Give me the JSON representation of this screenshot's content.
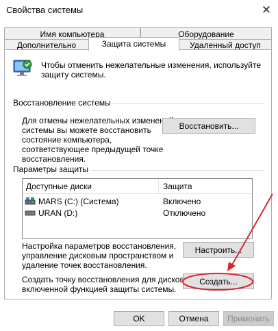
{
  "window": {
    "title": "Свойства системы",
    "close_glyph": "✕"
  },
  "tabs": {
    "row_back": [
      "Имя компьютера",
      "Оборудование"
    ],
    "row_front": [
      "Дополнительно",
      "Защита системы",
      "Удаленный доступ"
    ],
    "active": "Защита системы"
  },
  "intro": {
    "icon": "system-shield-icon",
    "line1": "Чтобы отменить нежелательные изменения, используйте",
    "line2": "защиту системы."
  },
  "restore": {
    "group_label": "Восстановление системы",
    "line1": "Для отмены нежелательных изменений",
    "line2": "системы вы можете восстановить",
    "line3": "состояние компьютера, соответствующее предыдущей точке",
    "line3a": "состояние компьютера,",
    "line4": "соответствующее предыдущей точке",
    "line5": "восстановления.",
    "button": "Восстановить..."
  },
  "protection": {
    "group_label": "Параметры защиты",
    "columns": [
      "Доступные диски",
      "Защита"
    ],
    "drives": [
      {
        "name": "MARS (C:) (Система)",
        "status": "Включено",
        "icon": "system-drive-icon"
      },
      {
        "name": "URAN (D:)",
        "status": "Отключено",
        "icon": "drive-icon"
      }
    ],
    "configure_line1": "Настройка параметров восстановления,",
    "configure_line2": "управление дисковым пространством и",
    "configure_line3": "удаление точек восстановления.",
    "configure_button": "Настроить...",
    "create_line1": "Создать точку восстановления для дисков с",
    "create_line2": "включенной функцией защиты системы.",
    "create_button": "Создать..."
  },
  "footer": {
    "ok": "OK",
    "cancel": "Отмена",
    "apply": "Применить"
  },
  "colors": {
    "annotation": "#d9262b"
  }
}
